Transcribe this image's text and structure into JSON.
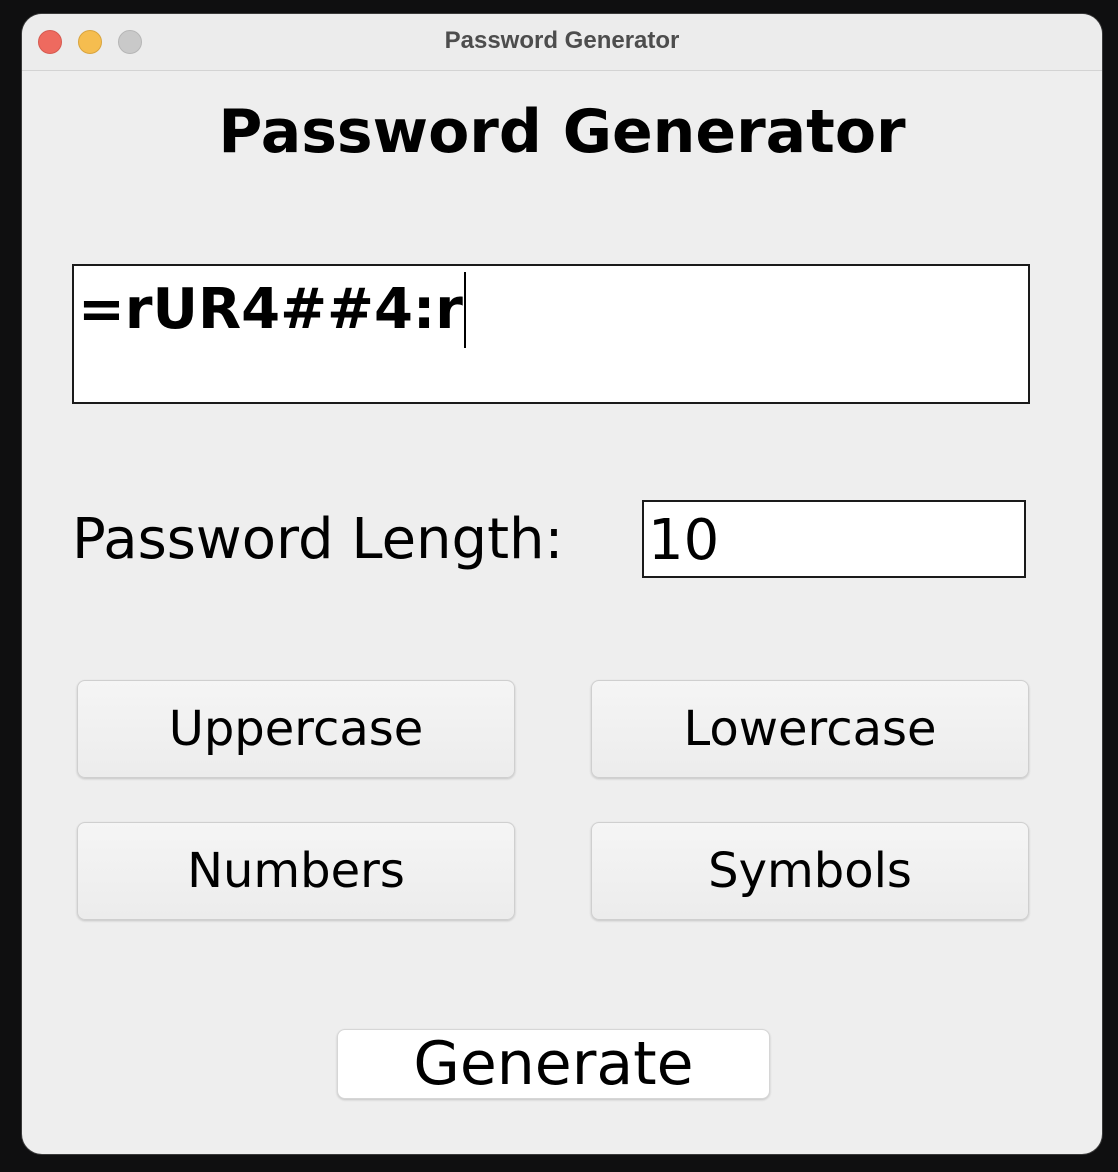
{
  "window": {
    "title": "Password Generator"
  },
  "heading": "Password Generator",
  "output": {
    "value": "=rUR4##4:r"
  },
  "length": {
    "label": "Password Length:",
    "value": "10"
  },
  "options": {
    "uppercase": "Uppercase",
    "lowercase": "Lowercase",
    "numbers": "Numbers",
    "symbols": "Symbols"
  },
  "generate_label": "Generate",
  "colors": {
    "window_bg": "#eeeeee",
    "close": "#ee6a5f",
    "minimize": "#f5bd4f",
    "maximize": "#c9c9c9"
  }
}
